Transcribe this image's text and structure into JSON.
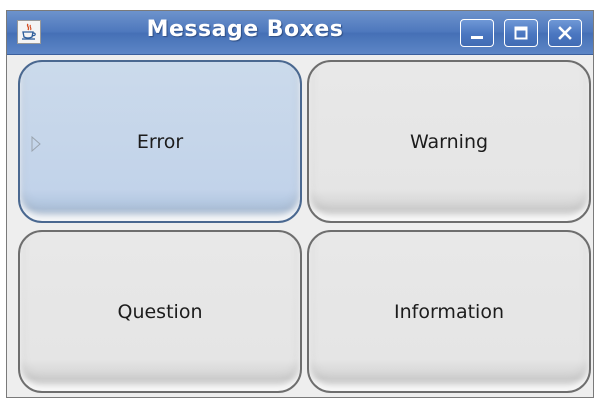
{
  "window": {
    "title": "Message Boxes",
    "icons": {
      "app": "java-coffee-cup-icon",
      "minimize": "minimize-icon",
      "maximize": "maximize-icon",
      "close": "close-icon"
    }
  },
  "buttons": [
    {
      "label": "Error",
      "focused": true
    },
    {
      "label": "Warning",
      "focused": false
    },
    {
      "label": "Question",
      "focused": false
    },
    {
      "label": "Information",
      "focused": false
    }
  ],
  "colors": {
    "titlebar": "#4e78bd",
    "focused_button": "#c2d3ea",
    "button": "#e5e5e5"
  }
}
